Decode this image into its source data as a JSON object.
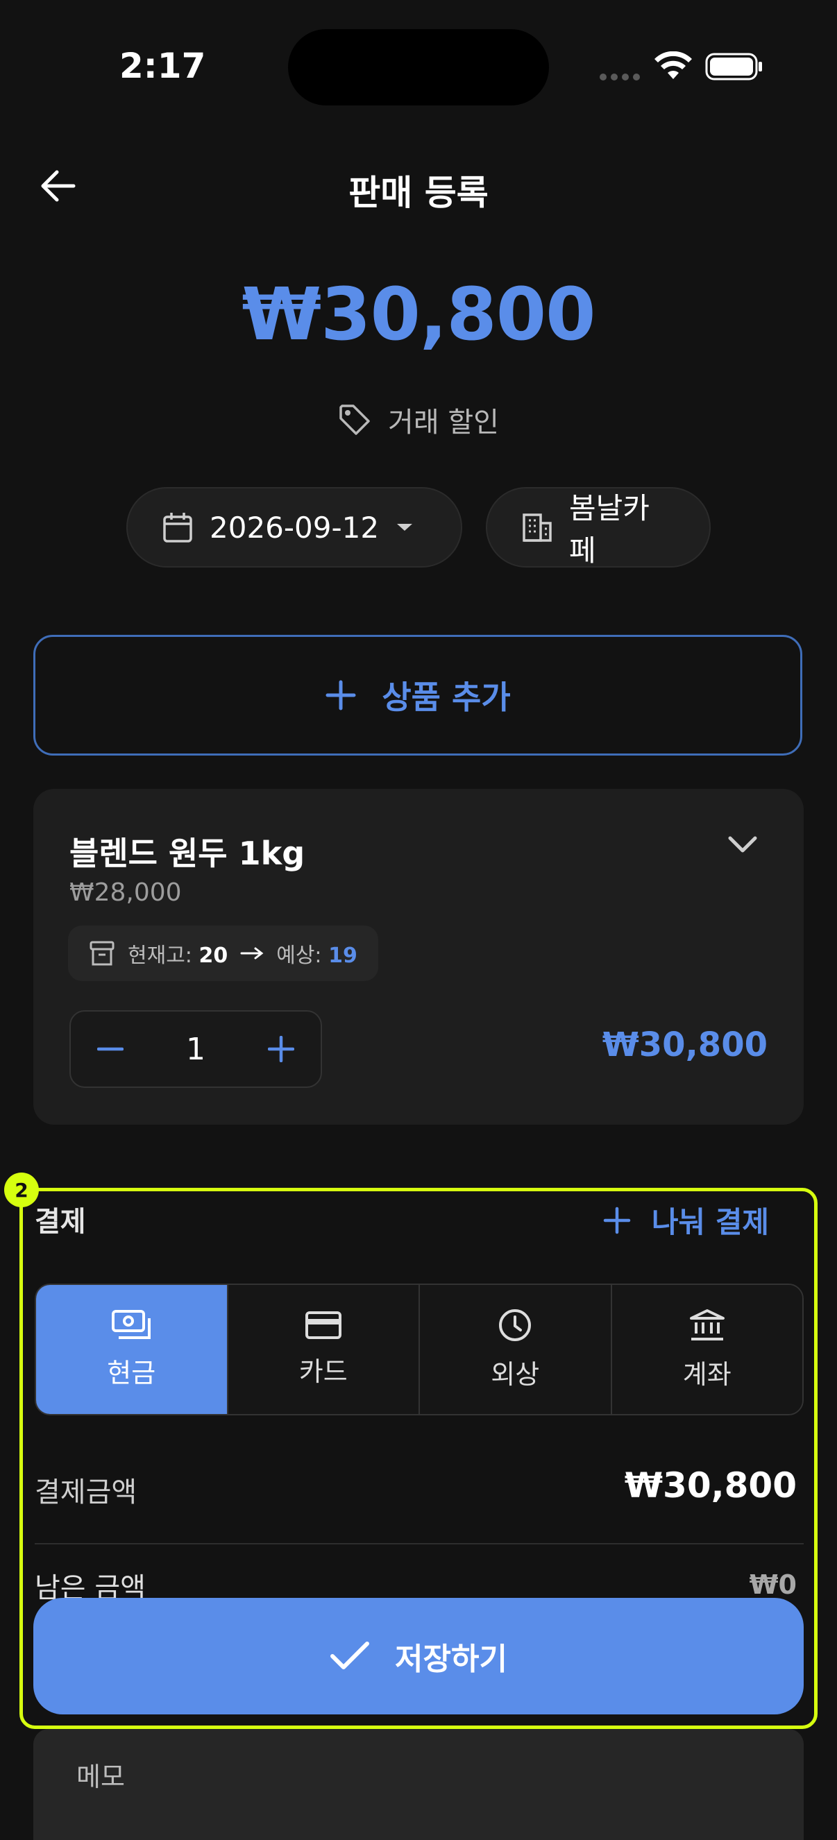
{
  "status_bar": {
    "time": "2:17"
  },
  "header": {
    "title": "판매 등록"
  },
  "summary": {
    "total": "₩30,800",
    "discount_label": "거래 할인"
  },
  "filters": {
    "date": "2026-09-12",
    "store": "봄날카페"
  },
  "add_product_label": "상품 추가",
  "product": {
    "name": "블렌드 원두 1kg",
    "unit_price": "₩28,000",
    "stock_label": "현재고:",
    "stock_current": "20",
    "stock_expected_label": "예상:",
    "stock_expected": "19",
    "quantity": "1",
    "line_total": "₩30,800"
  },
  "payment": {
    "badge": "2",
    "title": "결제",
    "split_label": "나눠 결제",
    "methods": [
      {
        "label": "현금",
        "icon": "cash-icon",
        "active": true
      },
      {
        "label": "카드",
        "icon": "card-icon",
        "active": false
      },
      {
        "label": "외상",
        "icon": "clock-icon",
        "active": false
      },
      {
        "label": "계좌",
        "icon": "bank-icon",
        "active": false
      }
    ],
    "amount_label": "결제금액",
    "amount_value": "₩30,800",
    "remaining_label": "남은 금액",
    "remaining_value": "₩0"
  },
  "save_label": "저장하기",
  "memo_label": "메모",
  "colors": {
    "accent": "#5a8de9",
    "highlight": "#d6ff0f",
    "background": "#121212"
  }
}
